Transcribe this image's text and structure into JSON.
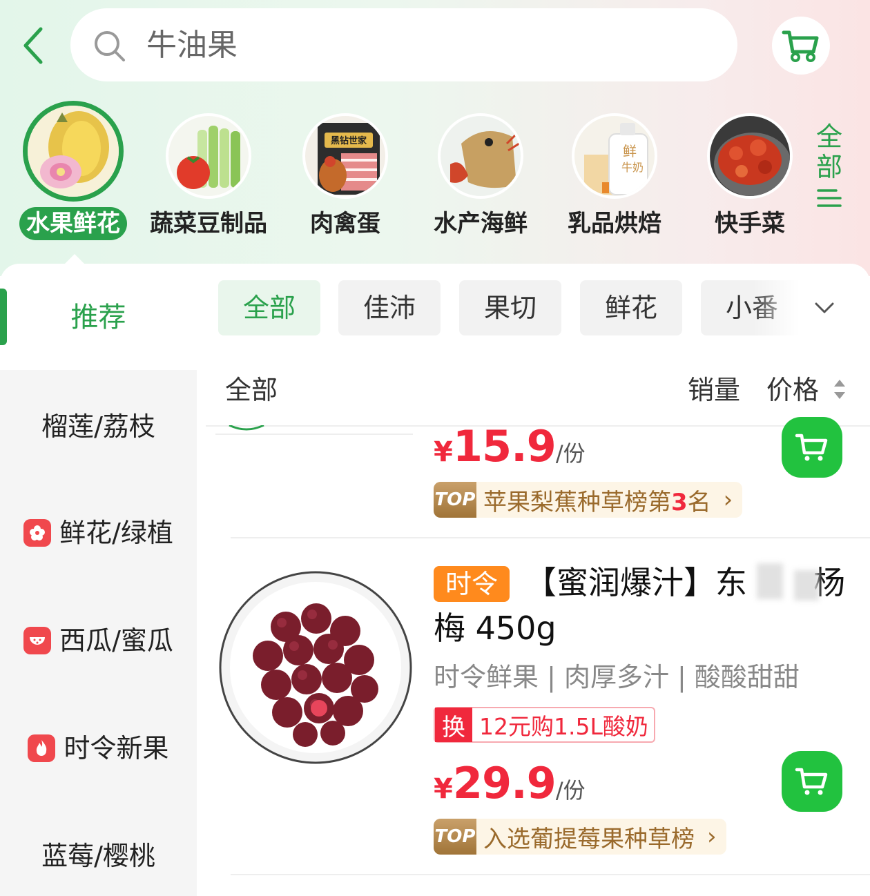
{
  "header": {
    "search_text": "牛油果"
  },
  "categories": [
    {
      "label": "水果鲜花",
      "active": true
    },
    {
      "label": "蔬菜豆制品"
    },
    {
      "label": "肉禽蛋"
    },
    {
      "label": "水产海鲜"
    },
    {
      "label": "乳品烘焙"
    },
    {
      "label": "快手菜"
    }
  ],
  "category_badges": {
    "meat_brand": "黑钻世家",
    "milk_text_1": "鲜",
    "milk_text_2": "牛奶"
  },
  "all_categories": {
    "line1": "全",
    "line2": "部"
  },
  "sidebar": {
    "recommend": "推荐",
    "items": [
      {
        "label": "榴莲/荔枝",
        "icon": "none"
      },
      {
        "label": "鲜花/绿植",
        "icon": "flower-icon"
      },
      {
        "label": "西瓜/蜜瓜",
        "icon": "watermelon-icon"
      },
      {
        "label": "时令新果",
        "icon": "flame-icon"
      },
      {
        "label": "蓝莓/樱桃",
        "icon": "none"
      }
    ]
  },
  "chips": [
    {
      "label": "全部",
      "active": true
    },
    {
      "label": "佳沛"
    },
    {
      "label": "果切"
    },
    {
      "label": "鲜花"
    },
    {
      "label": "小番"
    }
  ],
  "sort": {
    "all": "全部",
    "sales": "销量",
    "price": "价格"
  },
  "products": [
    {
      "price_symbol": "¥",
      "price": "15.9",
      "unit": "/份",
      "rank_badge": "TOP",
      "rank_text_pre": "苹果梨蕉种草榜第",
      "rank_num": "3",
      "rank_text_post": "名",
      "arrow": "›"
    },
    {
      "tag": "时令",
      "title_line1": "【蜜润爆汁】东",
      "title_line1_end": "杨",
      "title_line2": "梅 450g",
      "subtitle": "时令鲜果 | 肉厚多汁 | 酸酸甜甜",
      "promo_badge": "换",
      "promo_text": "12元购1.5L酸奶",
      "price_symbol": "¥",
      "price": "29.9",
      "unit": "/份",
      "rank_badge": "TOP",
      "rank_text": "入选葡提莓果种草榜",
      "arrow": "›"
    }
  ],
  "colors": {
    "accent_green": "#2aa14c",
    "cart_green": "#22c23f",
    "price_red": "#f0283c",
    "season_orange": "#ff8a1d"
  }
}
